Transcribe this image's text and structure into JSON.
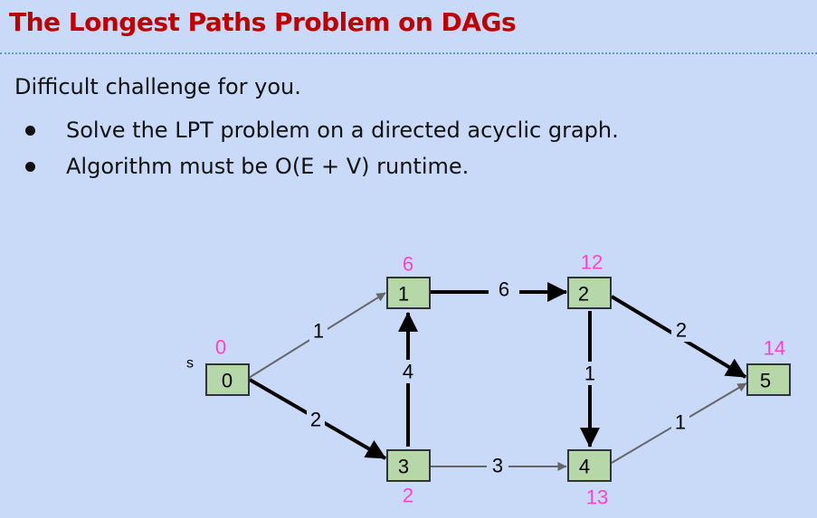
{
  "slide": {
    "title": "The Longest Paths Problem on DAGs",
    "intro": "Difficult challenge for you.",
    "bullets": [
      "Solve the LPT problem on a directed acyclic graph.",
      "Algorithm must be O(E + V) runtime."
    ]
  },
  "graph": {
    "source_label": "s",
    "nodes": [
      {
        "id": "0",
        "dist": "0"
      },
      {
        "id": "1",
        "dist": "6"
      },
      {
        "id": "2",
        "dist": "12"
      },
      {
        "id": "3",
        "dist": "2"
      },
      {
        "id": "4",
        "dist": "13"
      },
      {
        "id": "5",
        "dist": "14"
      }
    ],
    "edges": [
      {
        "from": "0",
        "to": "1",
        "weight": "1",
        "bold": false
      },
      {
        "from": "0",
        "to": "3",
        "weight": "2",
        "bold": true
      },
      {
        "from": "3",
        "to": "1",
        "weight": "4",
        "bold": true
      },
      {
        "from": "1",
        "to": "2",
        "weight": "6",
        "bold": true
      },
      {
        "from": "3",
        "to": "4",
        "weight": "3",
        "bold": false
      },
      {
        "from": "2",
        "to": "4",
        "weight": "1",
        "bold": true
      },
      {
        "from": "2",
        "to": "5",
        "weight": "2",
        "bold": true
      },
      {
        "from": "4",
        "to": "5",
        "weight": "1",
        "bold": false
      }
    ],
    "colors": {
      "node_fill": "#b6d7a8",
      "distance_label": "#ff3fd0",
      "bold_edge": "#000000",
      "thin_edge": "#666666"
    }
  }
}
